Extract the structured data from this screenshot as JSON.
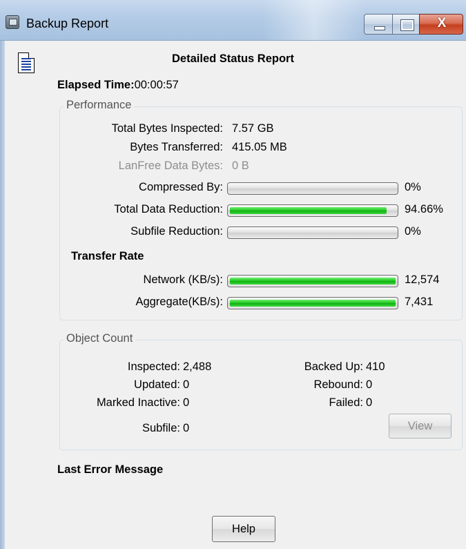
{
  "window": {
    "title": "Backup Report",
    "close_glyph": "X"
  },
  "heading": "Detailed Status Report",
  "elapsed": {
    "label": "Elapsed Time:",
    "value": "00:00:57"
  },
  "performance": {
    "legend": "Performance",
    "rows": [
      {
        "label": "Total Bytes Inspected:",
        "value": "7.57 GB"
      },
      {
        "label": "Bytes Transferred:",
        "value": "415.05 MB"
      },
      {
        "label": "LanFree Data Bytes:",
        "value": "0 B",
        "disabled": true
      }
    ],
    "bars": [
      {
        "label": "Compressed By:",
        "value": "0%",
        "fraction": 0
      },
      {
        "label": "Total Data Reduction:",
        "value": "94.66%",
        "fraction": 0.9466
      },
      {
        "label": "Subfile Reduction:",
        "value": "0%",
        "fraction": 0
      }
    ]
  },
  "transfer_rate": {
    "title": "Transfer Rate",
    "bars": [
      {
        "label": "Network (KB/s):",
        "value": "12,574",
        "fraction": 1.0
      },
      {
        "label": "Aggregate(KB/s):",
        "value": "7,431",
        "fraction": 1.0
      }
    ]
  },
  "object_count": {
    "legend": "Object Count",
    "inspected": {
      "label": "Inspected:",
      "value": "2,488"
    },
    "updated": {
      "label": "Updated:",
      "value": "0"
    },
    "marked_inactive": {
      "label": "Marked Inactive:",
      "value": "0"
    },
    "subfile": {
      "label": "Subfile:",
      "value": "0"
    },
    "backed_up": {
      "label": "Backed Up:",
      "value": "410"
    },
    "rebound": {
      "label": "Rebound:",
      "value": "0"
    },
    "failed": {
      "label": "Failed:",
      "value": "0"
    },
    "view_button": "View"
  },
  "last_error": {
    "title": "Last Error Message"
  },
  "help_button": "Help",
  "colors": {
    "progress_fill": "#1ec41e",
    "close_button": "#c3401f"
  },
  "icons": [
    "app-icon",
    "document-icon"
  ]
}
